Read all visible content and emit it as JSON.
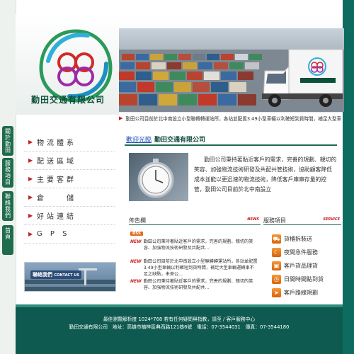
{
  "brand": {
    "name": "勤田交通有限公司",
    "colors": {
      "primary": "#0e5a50",
      "accent": "#c71f1f",
      "link": "#1e50b8"
    }
  },
  "marquee": {
    "text": "勤田公司目前於北中南設立小型聯轉轉運站所，各站並配置3.49小型車輛以利確短到貨時間，補足大型車"
  },
  "side_tabs": [
    {
      "label": "關於勤田"
    },
    {
      "label": "服務項目"
    },
    {
      "label": "聯絡我們"
    },
    {
      "label": "首頁"
    }
  ],
  "menu": {
    "items": [
      {
        "label": "物流體系"
      },
      {
        "label": "配送區域"
      },
      {
        "label": "主要客群"
      },
      {
        "label": "倉　　儲"
      },
      {
        "label": "好站連結"
      },
      {
        "label": "G P S"
      }
    ]
  },
  "contact": {
    "label": "聯絡我們",
    "label_en": "CONTACT US"
  },
  "welcome": {
    "title_prefix": "歡迎光臨",
    "title_company": "勤田交通有限公司",
    "body": "勤田公司秉持著貼近客戶的需求，完善的規劃、親切的笑容、加強物流技術研發及共配共管技術，協助顧客降低成本並能以更迅速的物流技術，降低客戶庫庫存量的控管，勤田公司目前於北中南設立"
  },
  "news": {
    "heading": "佈告欄",
    "heading_en": "NEWS",
    "rss": "RSS",
    "badge": "NEW",
    "items": [
      {
        "text": "勤田公司秉持著貼近客戶的需求，完善的規劃、親切的笑容、加強物流技術研發及共配共..."
      },
      {
        "text": "勤田公司目前於北中南設立小型聯轉轉運站所，各站並配置3.49小型車輛以利確短到貨時間，補足大型車輛運轉車不足之缺點，未來公..."
      },
      {
        "text": "勤田公司秉持著貼近客戶的需求，完善的規劃、親切的笑容、加強物流技術研發及共配共..."
      }
    ]
  },
  "service": {
    "heading": "服務項目",
    "heading_en": "SERVICE",
    "items": [
      {
        "label": "貨櫃拆裝送",
        "icon": "truck-icon"
      },
      {
        "label": "夜間急件服務",
        "icon": "moon-icon"
      },
      {
        "label": "客戶貨品理貨",
        "icon": "box-icon"
      },
      {
        "label": "日間時間點到貨",
        "icon": "clock-icon"
      },
      {
        "label": "客戶路線規劃",
        "icon": "route-icon"
      }
    ]
  },
  "footer": {
    "line1": "最佳瀏覽解析度 1024*768 若有任何疑問與指教，請至 / 客戶服務中心",
    "line2": "勤田交通有限公司　地址：高雄市楠梓區典西路121巷6號　電話：07-3544031　傳真：07-3544180"
  }
}
